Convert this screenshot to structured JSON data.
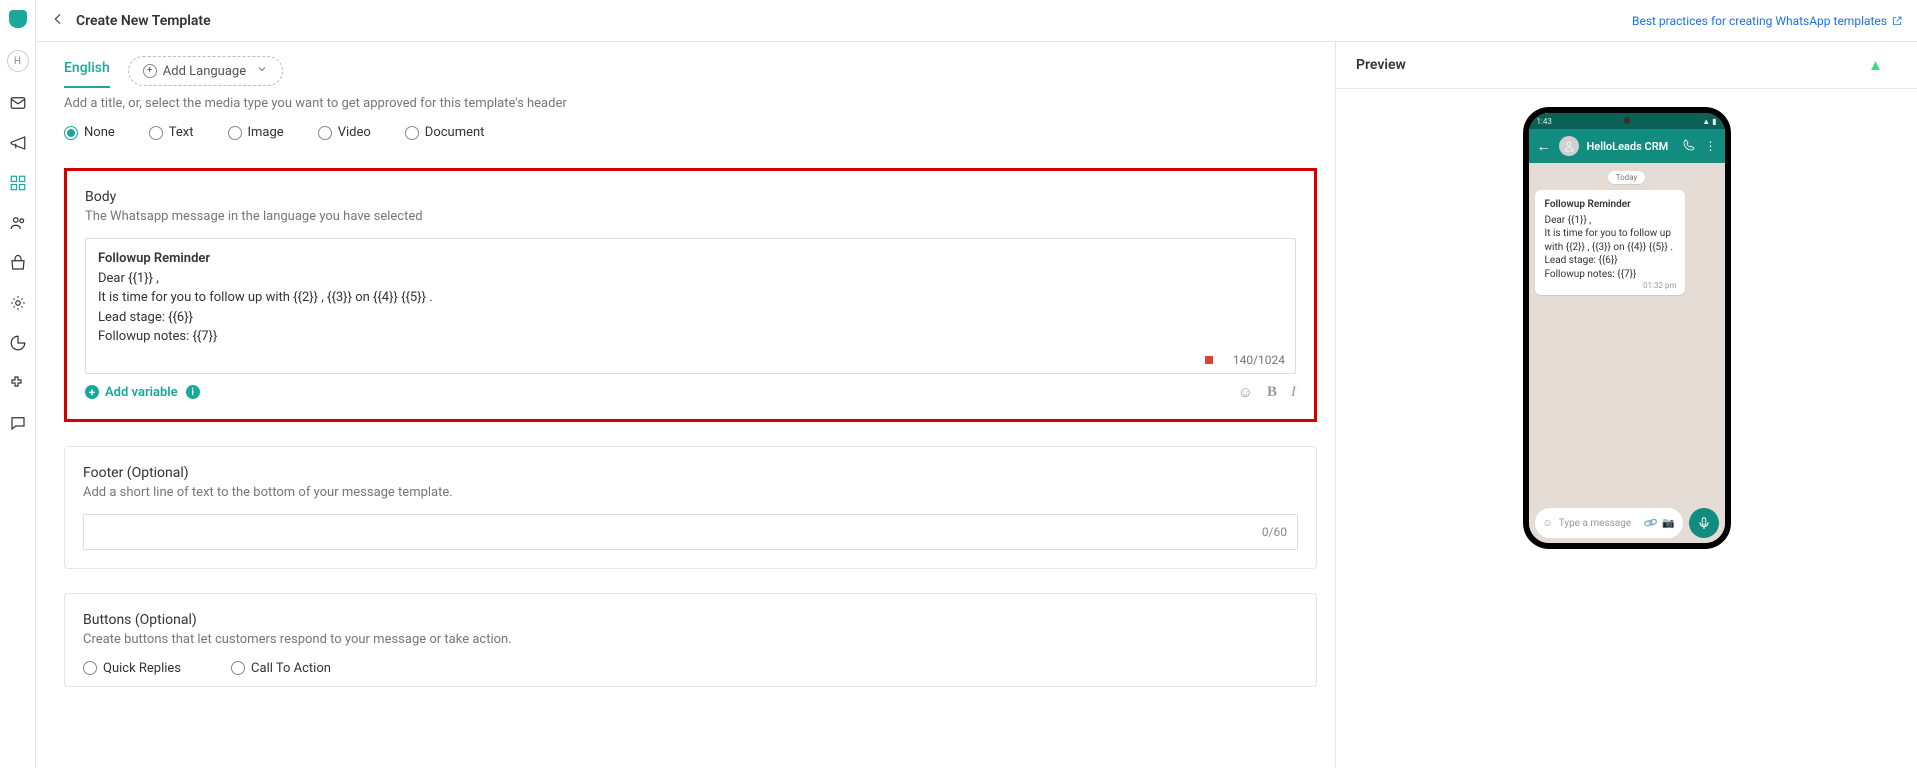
{
  "topbar": {
    "title": "Create New Template",
    "help_link": "Best practices for creating WhatsApp templates"
  },
  "sidebar": {
    "avatar_letter": "H"
  },
  "language": {
    "active_tab": "English",
    "add_label": "Add Language"
  },
  "header_section": {
    "desc": "Add a title, or, select the media type you want to get approved for this template's header",
    "options": [
      "None",
      "Text",
      "Image",
      "Video",
      "Document"
    ],
    "selected": "None"
  },
  "body_section": {
    "title": "Body",
    "desc": "The Whatsapp message in the language you have selected",
    "content_title": "Followup Reminder",
    "content_lines": "Dear {{1}} ,\nIt is time for you to follow up with {{2}} , {{3}} on {{4}} {{5}} .\nLead stage: {{6}}\nFollowup notes: {{7}}",
    "char_count": "140/1024",
    "add_variable_label": "Add variable"
  },
  "footer_section": {
    "title": "Footer (Optional)",
    "desc": "Add a short line of text to the bottom of your message template.",
    "char_count": "0/60"
  },
  "buttons_section": {
    "title": "Buttons (Optional)",
    "desc": "Create buttons that let customers respond to your message or take action.",
    "options": [
      "Quick Replies",
      "Call To Action"
    ]
  },
  "preview": {
    "title": "Preview",
    "phone_time": "1:43",
    "contact_name": "HelloLeads CRM",
    "today_label": "Today",
    "msg_title": "Followup Reminder",
    "msg_body": "Dear {{1}} ,\nIt is time for you to follow up with {{2}} , {{3}} on {{4}} {{5}} .\nLead stage: {{6}}\nFollowup notes: {{7}}",
    "msg_time": "01:32 pm",
    "input_placeholder": "Type a message"
  }
}
